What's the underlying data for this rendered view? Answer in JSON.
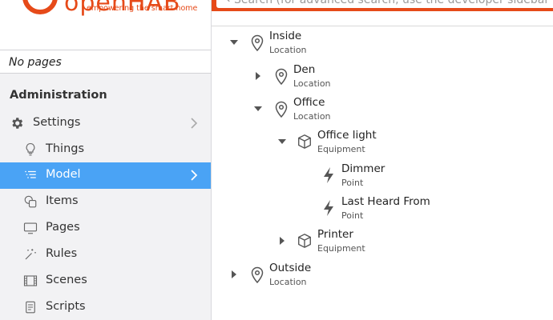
{
  "brand": {
    "name": "openHAB",
    "tagline": "empowering the smart home",
    "color": "#e64a19"
  },
  "sidebar": {
    "pages_empty": "No pages",
    "section_title": "Administration",
    "items": [
      {
        "label": "Settings",
        "icon": "gear-icon",
        "active": false,
        "has_chevron": true
      },
      {
        "label": "Things",
        "icon": "lightbulb-icon",
        "active": false
      },
      {
        "label": "Model",
        "icon": "list-icon",
        "active": true,
        "has_chevron": true
      },
      {
        "label": "Items",
        "icon": "items-icon",
        "active": false
      },
      {
        "label": "Pages",
        "icon": "display-icon",
        "active": false
      },
      {
        "label": "Rules",
        "icon": "wand-icon",
        "active": false
      },
      {
        "label": "Scenes",
        "icon": "film-icon",
        "active": false
      },
      {
        "label": "Scripts",
        "icon": "script-icon",
        "active": false
      }
    ],
    "active_color": "#4aa3f5"
  },
  "search": {
    "placeholder": "Search (for advanced search, use the developer sidebar (S"
  },
  "tree": [
    {
      "title": "Inside",
      "type": "Location",
      "icon": "location-pin-icon",
      "state": "expanded"
    },
    {
      "title": "Den",
      "type": "Location",
      "icon": "location-pin-icon",
      "state": "collapsed"
    },
    {
      "title": "Office",
      "type": "Location",
      "icon": "location-pin-icon",
      "state": "expanded"
    },
    {
      "title": "Office light",
      "type": "Equipment",
      "icon": "cube-icon",
      "state": "expanded"
    },
    {
      "title": "Dimmer",
      "type": "Point",
      "icon": "bolt-icon",
      "state": "leaf"
    },
    {
      "title": "Last Heard From",
      "type": "Point",
      "icon": "bolt-icon",
      "state": "leaf"
    },
    {
      "title": "Printer",
      "type": "Equipment",
      "icon": "cube-icon",
      "state": "collapsed"
    },
    {
      "title": "Outside",
      "type": "Location",
      "icon": "location-pin-icon",
      "state": "collapsed"
    }
  ]
}
